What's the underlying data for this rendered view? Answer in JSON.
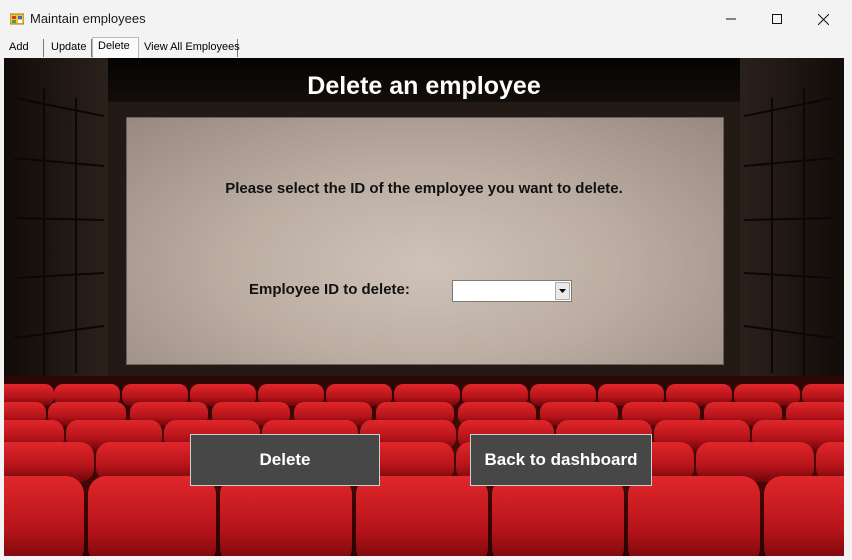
{
  "window": {
    "title": "Maintain employees",
    "controls": [
      "minimize-icon",
      "maximize-icon",
      "close-icon"
    ]
  },
  "tabs": [
    {
      "label": "Add"
    },
    {
      "label": "Update"
    },
    {
      "label": "Delete",
      "selected": true
    },
    {
      "label": "View All Employees"
    }
  ],
  "main": {
    "heading": "Delete an employee",
    "prompt": "Please select the ID of the employee you want to delete.",
    "employee_id_label": "Employee ID to delete:",
    "employee_id_value": "",
    "delete_button": "Delete",
    "back_button": "Back to dashboard"
  },
  "colors": {
    "button_bg": "#474747",
    "seat_red": "#c0181c",
    "screen": "#c7b9ae"
  }
}
